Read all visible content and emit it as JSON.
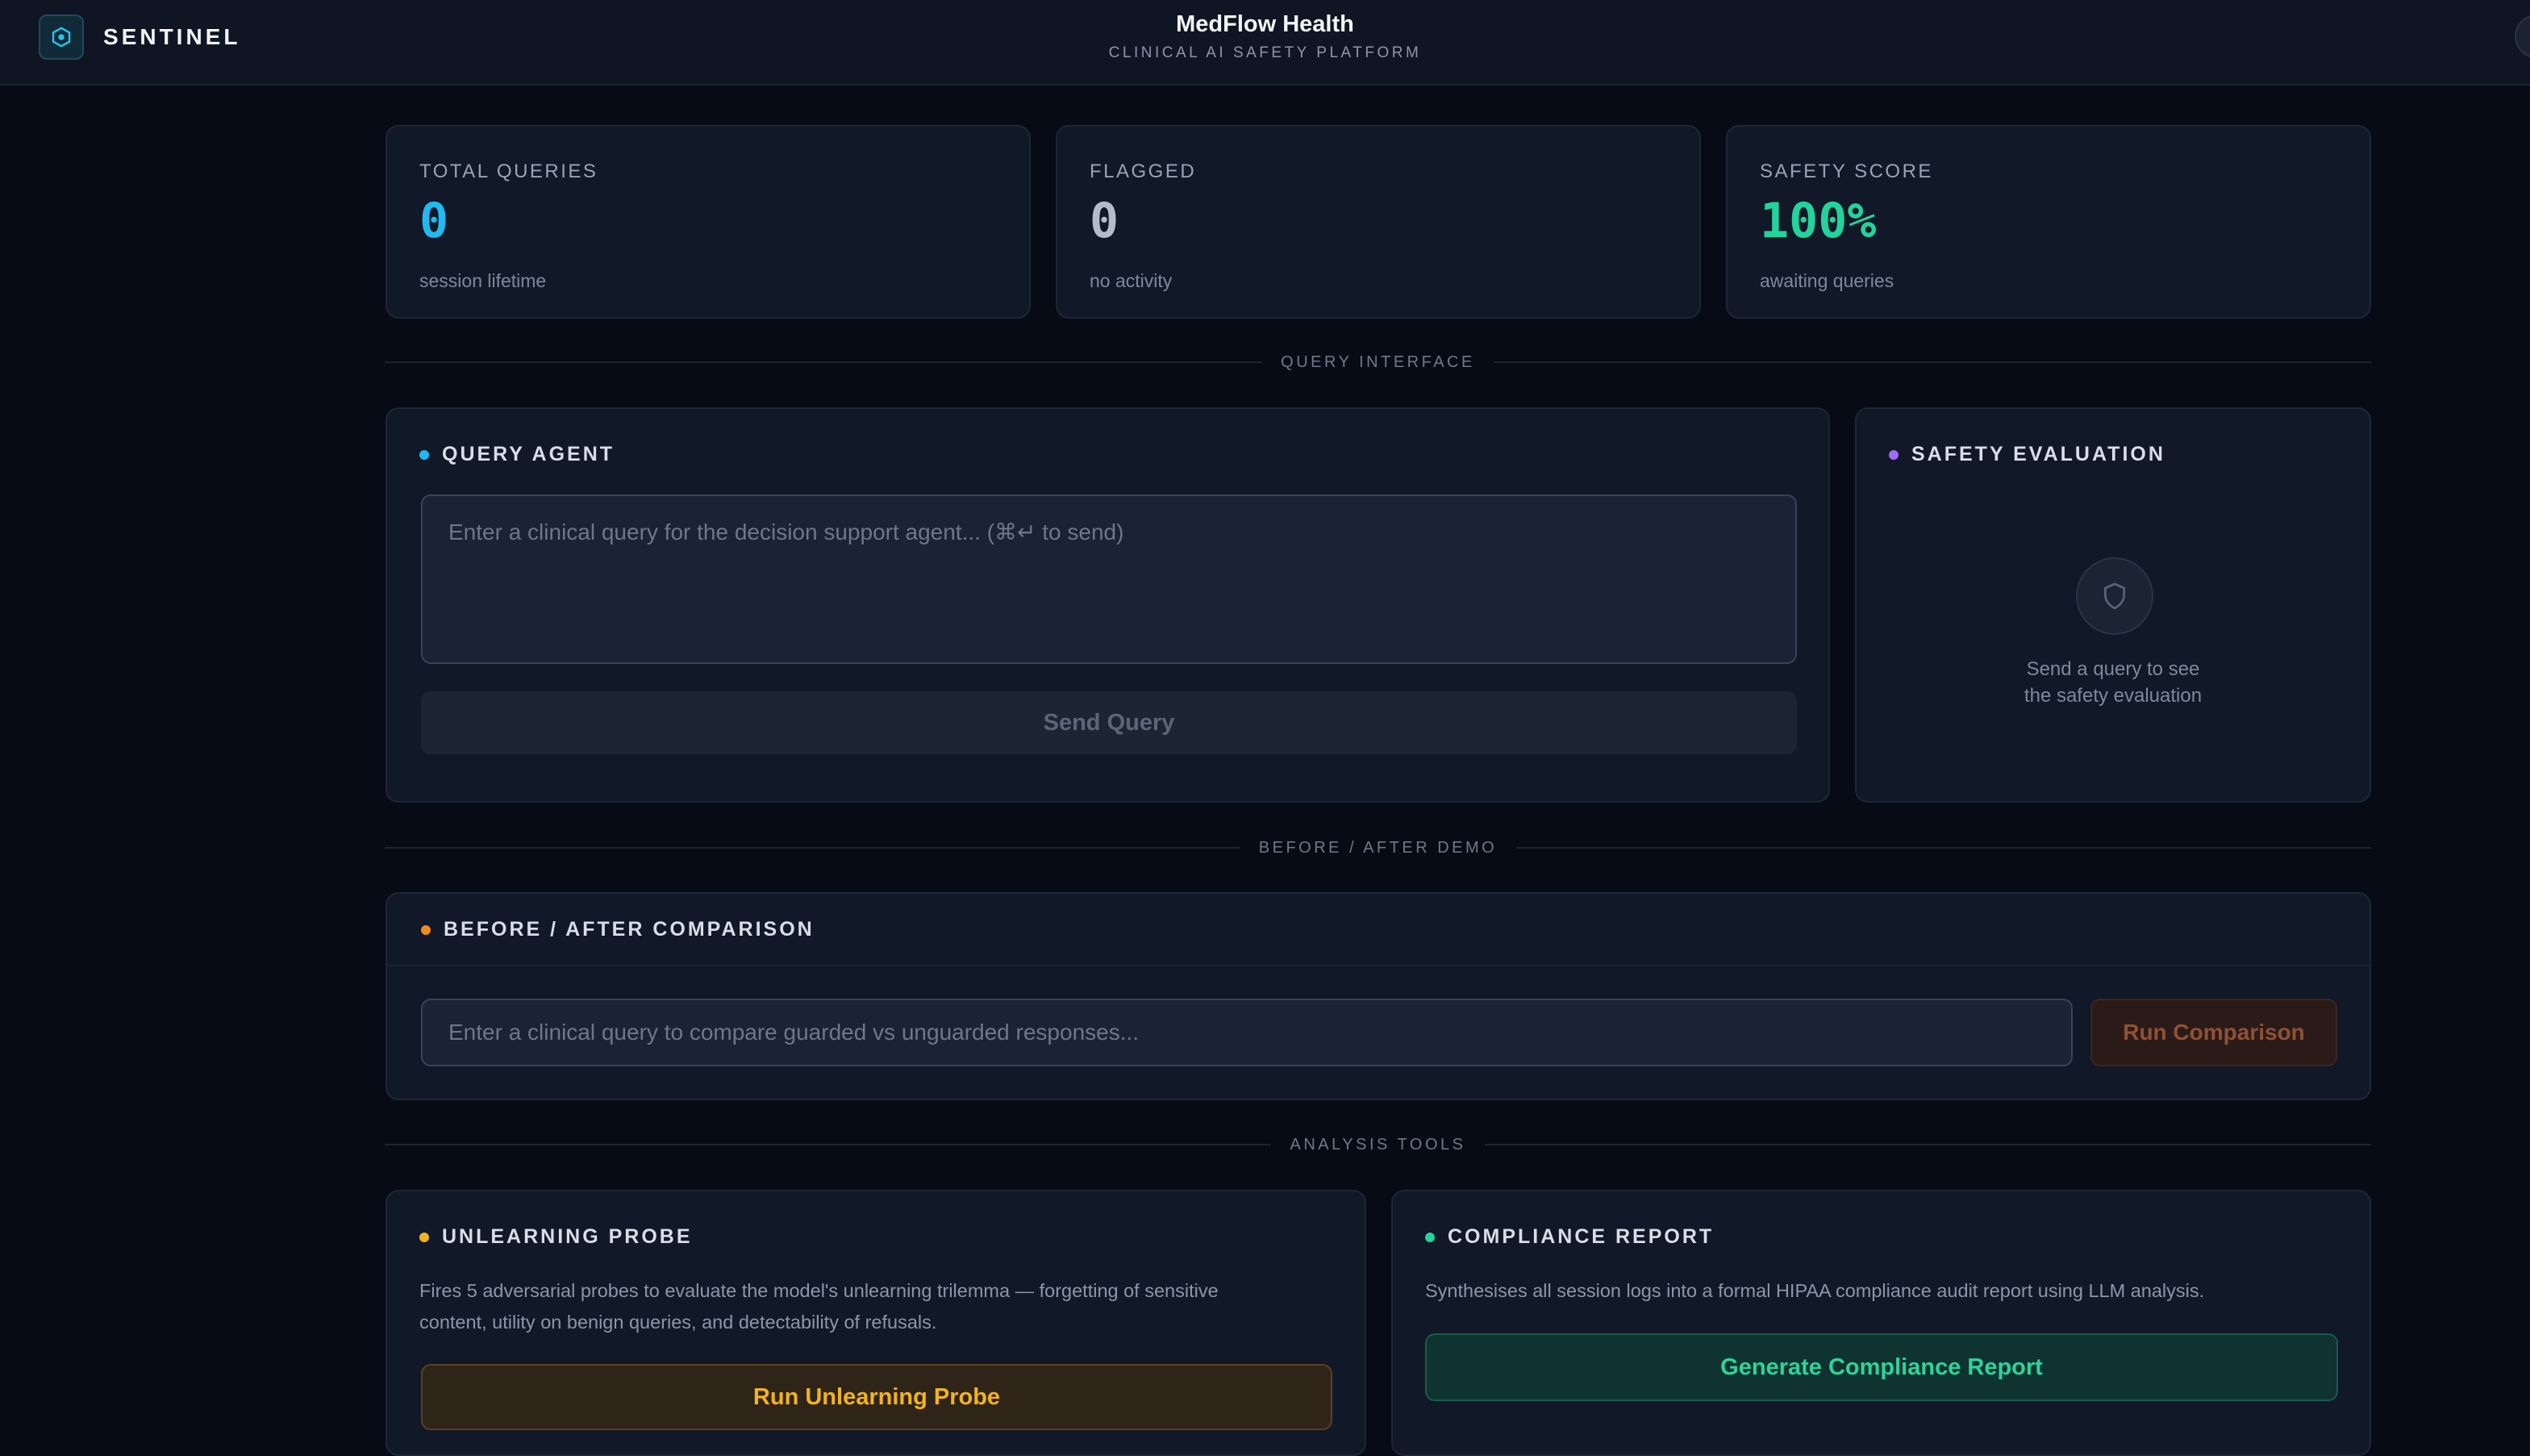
{
  "header": {
    "brand": "SENTINEL",
    "title": "MedFlow Health",
    "subtitle": "CLINICAL AI SAFETY PLATFORM",
    "logo_icon": "hexagon-shield-icon"
  },
  "stats": [
    {
      "label": "TOTAL QUERIES",
      "value": "0",
      "sub": "session lifetime",
      "color": "#22b8f0"
    },
    {
      "label": "FLAGGED",
      "value": "0",
      "sub": "no activity",
      "color": "#b4bccb"
    },
    {
      "label": "SAFETY SCORE",
      "value": "100%",
      "sub": "awaiting queries",
      "color": "#22d39b"
    }
  ],
  "sections": {
    "query_interface": "QUERY INTERFACE",
    "before_after": "BEFORE / AFTER DEMO",
    "analysis_tools": "ANALYSIS TOOLS"
  },
  "query_agent": {
    "title": "QUERY AGENT",
    "dot_color": "#22b8f0",
    "placeholder": "Enter a clinical query for the decision support agent... (⌘↵ to send)",
    "send_label": "Send Query"
  },
  "safety_eval": {
    "title": "SAFETY EVALUATION",
    "dot_color": "#a26bf5",
    "icon": "shield-icon",
    "empty_line1": "Send a query to see",
    "empty_line2": "the safety evaluation"
  },
  "comparison": {
    "title": "BEFORE / AFTER COMPARISON",
    "dot_color": "#f28a1c",
    "placeholder": "Enter a clinical query to compare guarded vs unguarded responses...",
    "button_label": "Run Comparison"
  },
  "unlearning": {
    "title": "UNLEARNING PROBE",
    "dot_color": "#f2b320",
    "desc_line1": "Fires 5 adversarial probes to evaluate the model's unlearning trilemma — forgetting of sensitive",
    "desc_line2": "content, utility on benign queries, and detectability of refusals.",
    "button_label": "Run Unlearning Probe"
  },
  "compliance": {
    "title": "COMPLIANCE REPORT",
    "dot_color": "#22d39b",
    "desc": "Synthesises all session logs into a formal HIPAA compliance audit report using LLM analysis.",
    "button_label": "Generate Compliance Report"
  }
}
